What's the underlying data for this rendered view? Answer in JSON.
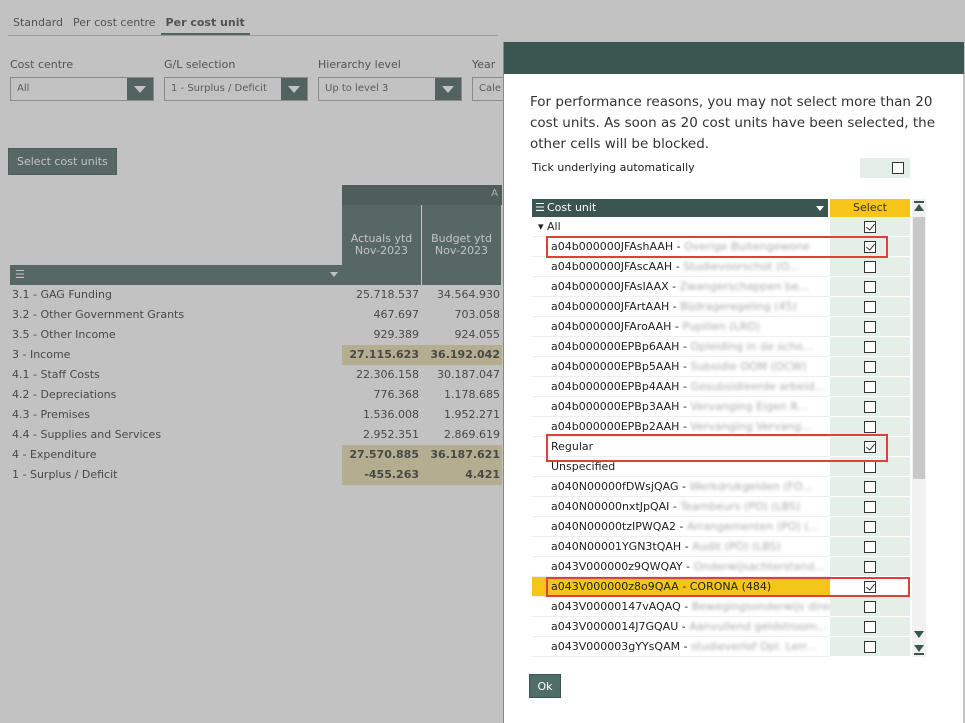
{
  "tabs": [
    {
      "label": "Standard",
      "active": false
    },
    {
      "label": "Per cost centre",
      "active": false
    },
    {
      "label": "Per cost unit",
      "active": true
    }
  ],
  "filters": [
    {
      "label": "Cost centre",
      "value": "All"
    },
    {
      "label": "G/L selection",
      "value": "1 - Surplus / Deficit"
    },
    {
      "label": "Hierarchy level",
      "value": "Up to level 3"
    },
    {
      "label": "Year",
      "value": "Cale"
    }
  ],
  "select_cost_units_label": "Select cost units",
  "report": {
    "group_head": "A",
    "columns": [
      {
        "line1": "Actuals ytd",
        "line2": "Nov-2023"
      },
      {
        "line1": "Budget ytd",
        "line2": "Nov-2023"
      }
    ],
    "menu_glyph": "☰",
    "rows": [
      {
        "label": "3.1 - GAG Funding",
        "v1": "25.718.537",
        "v2": "34.564.930",
        "total": false
      },
      {
        "label": "3.2 - Other Government Grants",
        "v1": "467.697",
        "v2": "703.058",
        "total": false
      },
      {
        "label": "3.5 - Other Income",
        "v1": "929.389",
        "v2": "924.055",
        "total": false
      },
      {
        "label": "3 - Income",
        "v1": "27.115.623",
        "v2": "36.192.042",
        "total": true
      },
      {
        "label": "4.1 - Staff Costs",
        "v1": "22.306.158",
        "v2": "30.187.047",
        "total": false
      },
      {
        "label": "4.2 - Depreciations",
        "v1": "776.368",
        "v2": "1.178.685",
        "total": false
      },
      {
        "label": "4.3 - Premises",
        "v1": "1.536.008",
        "v2": "1.952.271",
        "total": false
      },
      {
        "label": "4.4 - Supplies and Services",
        "v1": "2.952.351",
        "v2": "2.869.619",
        "total": false
      },
      {
        "label": "4 - Expenditure",
        "v1": "27.570.885",
        "v2": "36.187.621",
        "total": true
      },
      {
        "label": "1 - Surplus / Deficit",
        "v1": "-455.263",
        "v2": "4.421",
        "total": true
      }
    ]
  },
  "modal": {
    "message": "For performance reasons, you may not select more than 20 cost units. As soon as 20 cost units have been selected, the other cells will be blocked.",
    "tick_label": "Tick underlying automatically",
    "tick_checked": false,
    "grid_head_menu": "☰",
    "grid_head_label": "Cost unit",
    "select_head_label": "Select",
    "ok_label": "Ok",
    "rows": [
      {
        "code": "▾ All",
        "desc": "",
        "checked": true,
        "indent": 0
      },
      {
        "code": "a04b000000JFAshAAH - ",
        "desc": "Overige Buitengewone",
        "checked": true
      },
      {
        "code": "a04b000000JFAscAAH - ",
        "desc": "Studievoorschot (O...",
        "checked": false
      },
      {
        "code": "a04b000000JFAsIAAX - ",
        "desc": "Zwangerschappen be...",
        "checked": false
      },
      {
        "code": "a04b000000JFArtAAH - ",
        "desc": "Bijdrageregeling (45)",
        "checked": false
      },
      {
        "code": "a04b000000JFAroAAH - ",
        "desc": "Pupillen (LRO)",
        "checked": false
      },
      {
        "code": "a04b000000EPBp6AAH - ",
        "desc": "Opleiding in de scho...",
        "checked": false
      },
      {
        "code": "a04b000000EPBp5AAH - ",
        "desc": "Subsidie OOM (OCW)",
        "checked": false
      },
      {
        "code": "a04b000000EPBp4AAH - ",
        "desc": "Gesubsidieerde arbeid...",
        "checked": false
      },
      {
        "code": "a04b000000EPBp3AAH - ",
        "desc": "Vervanging Eigen R...",
        "checked": false
      },
      {
        "code": "a04b000000EPBp2AAH - ",
        "desc": "Vervanging Vervang...",
        "checked": false
      },
      {
        "code": "Regular",
        "desc": "",
        "checked": true
      },
      {
        "code": "Unspecified",
        "desc": "",
        "checked": false
      },
      {
        "code": "a040N00000fDWsjQAG - ",
        "desc": "Werkdrukgelden (FO...",
        "checked": false
      },
      {
        "code": "a040N00000nxtJpQAI - ",
        "desc": "Teambeurs (PO) (LBS)",
        "checked": false
      },
      {
        "code": "a040N00000tzIPWQA2 - ",
        "desc": "Arrangementen (PO) (...",
        "checked": false
      },
      {
        "code": "a040N00001YGN3tQAH - ",
        "desc": "Audit (PO) (LBS)",
        "checked": false
      },
      {
        "code": "a043V000000z9QWQAY - ",
        "desc": "Onderwijsachterstand...",
        "checked": false
      },
      {
        "code": "a043V000000z8o9QAA - CORONA (484)",
        "desc": "",
        "checked": true,
        "highlight": true
      },
      {
        "code": "a043V00000147vAQAQ - ",
        "desc": "Bewegingsonderwijs direct...",
        "checked": false
      },
      {
        "code": "a043V0000014J7GQAU - ",
        "desc": "Aanvullend geldstroom...",
        "checked": false
      },
      {
        "code": "a043V000003gYYsQAM - ",
        "desc": "studieverlof Opl. Lerr...",
        "checked": false
      }
    ]
  }
}
